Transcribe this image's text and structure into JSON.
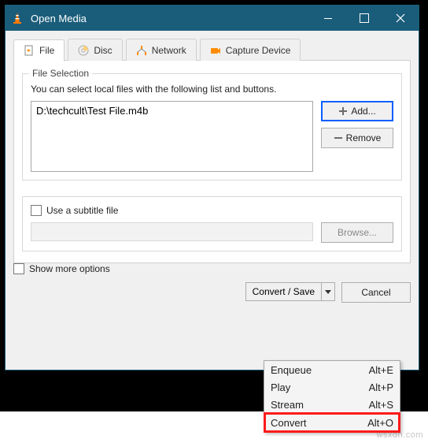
{
  "window": {
    "title": "Open Media"
  },
  "tabs": {
    "file": "File",
    "disc": "Disc",
    "network": "Network",
    "capture": "Capture Device"
  },
  "file_selection": {
    "title": "File Selection",
    "help": "You can select local files with the following list and buttons.",
    "files": [
      "D:\\techcult\\Test File.m4b"
    ],
    "add": "Add...",
    "remove": "Remove"
  },
  "subtitle": {
    "label": "Use a subtitle file",
    "browse": "Browse..."
  },
  "show_more": "Show more options",
  "buttons": {
    "convert_save": "Convert / Save",
    "cancel": "Cancel"
  },
  "menu": {
    "enqueue": {
      "label": "Enqueue",
      "shortcut": "Alt+E"
    },
    "play": {
      "label": "Play",
      "shortcut": "Alt+P"
    },
    "stream": {
      "label": "Stream",
      "shortcut": "Alt+S"
    },
    "convert": {
      "label": "Convert",
      "shortcut": "Alt+O"
    }
  },
  "watermark": "wsxdn.com"
}
